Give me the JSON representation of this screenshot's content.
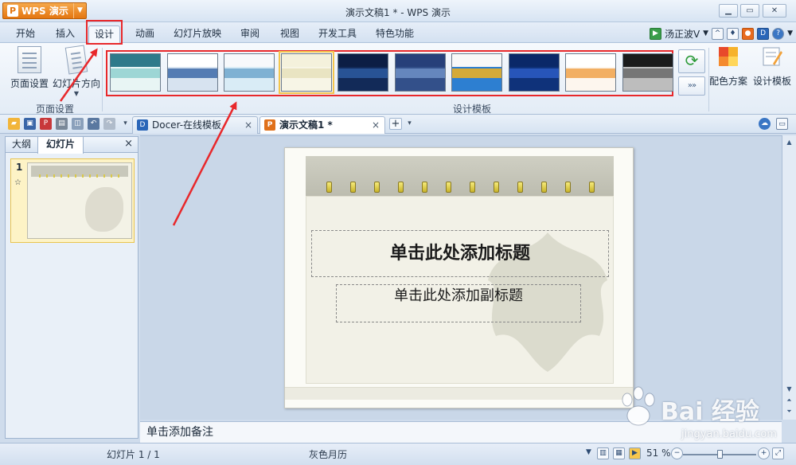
{
  "app": {
    "button_label": "WPS 演示",
    "logo_glyph": "P",
    "window_title": "演示文稿1 * - WPS 演示"
  },
  "menu": {
    "tabs": [
      "开始",
      "插入",
      "设计",
      "动画",
      "幻灯片放映",
      "审阅",
      "视图",
      "开发工具",
      "特色功能"
    ],
    "active_tab": "设计",
    "user_name": "汤正波V"
  },
  "ribbon": {
    "page_setup_label": "页面设置",
    "slide_orientation_label": "幻灯片方向",
    "page_group_label": "页面设置",
    "template_group_label": "设计模板",
    "color_scheme_label": "配色方案",
    "design_template_label": "设计模板",
    "more_label": "»»",
    "templates": [
      {
        "top": "#2f7a8a",
        "mid": "#8fd0cf",
        "bottom": "#e8f5f4"
      },
      {
        "top": "#ffffff",
        "mid": "#3d6aa8",
        "bottom": "#d7e3f0"
      },
      {
        "top": "#f7f9fb",
        "mid": "#6fa7cc",
        "bottom": "#d9ecf6"
      },
      {
        "top": "#f4f1dc",
        "mid": "#e6e1bb",
        "bottom": "#f7f5e6"
      },
      {
        "top": "#0c1e44",
        "mid": "#2d5aa0",
        "bottom": "#122a58"
      },
      {
        "top": "#27407a",
        "mid": "#6e8fc6",
        "bottom": "#33508a"
      },
      {
        "top": "#f8f8f8",
        "mid": "#f2b21d",
        "bottom": "#2d7fd1"
      },
      {
        "top": "#0a2868",
        "mid": "#2b5cc4",
        "bottom": "#0f327a"
      },
      {
        "top": "#ffffff",
        "mid": "#f0a24a",
        "bottom": "#fdf6ee"
      },
      {
        "top": "#1b1b1b",
        "mid": "#6a6a6a",
        "bottom": "#bdbdbd"
      }
    ],
    "selected_template_index": 3
  },
  "doc_tabs": [
    {
      "label": "Docer-在线模板",
      "icon_glyph": "D",
      "icon_color": "#2a66b8"
    },
    {
      "label": "演示文稿1 *",
      "icon_glyph": "P",
      "icon_color": "#e0701a"
    }
  ],
  "left_pane": {
    "tab_outline": "大纲",
    "tab_slides": "幻灯片",
    "close_glyph": "×",
    "slide_number": "1"
  },
  "slide": {
    "title_placeholder": "单击此处添加标题",
    "subtitle_placeholder": "单击此处添加副标题"
  },
  "notes": {
    "placeholder": "单击添加备注"
  },
  "status": {
    "slide_counter": "幻灯片 1 / 1",
    "theme_name": "灰色月历",
    "zoom": "51 %",
    "zoom_fraction": 0.51
  },
  "watermark": {
    "brand": "Bai 经验",
    "url": "jingyan.baidu.com"
  },
  "colors": {
    "highlight": "#e8282b",
    "app_orange": "#e47610",
    "ribbon_bg": "#e3ecf6"
  }
}
